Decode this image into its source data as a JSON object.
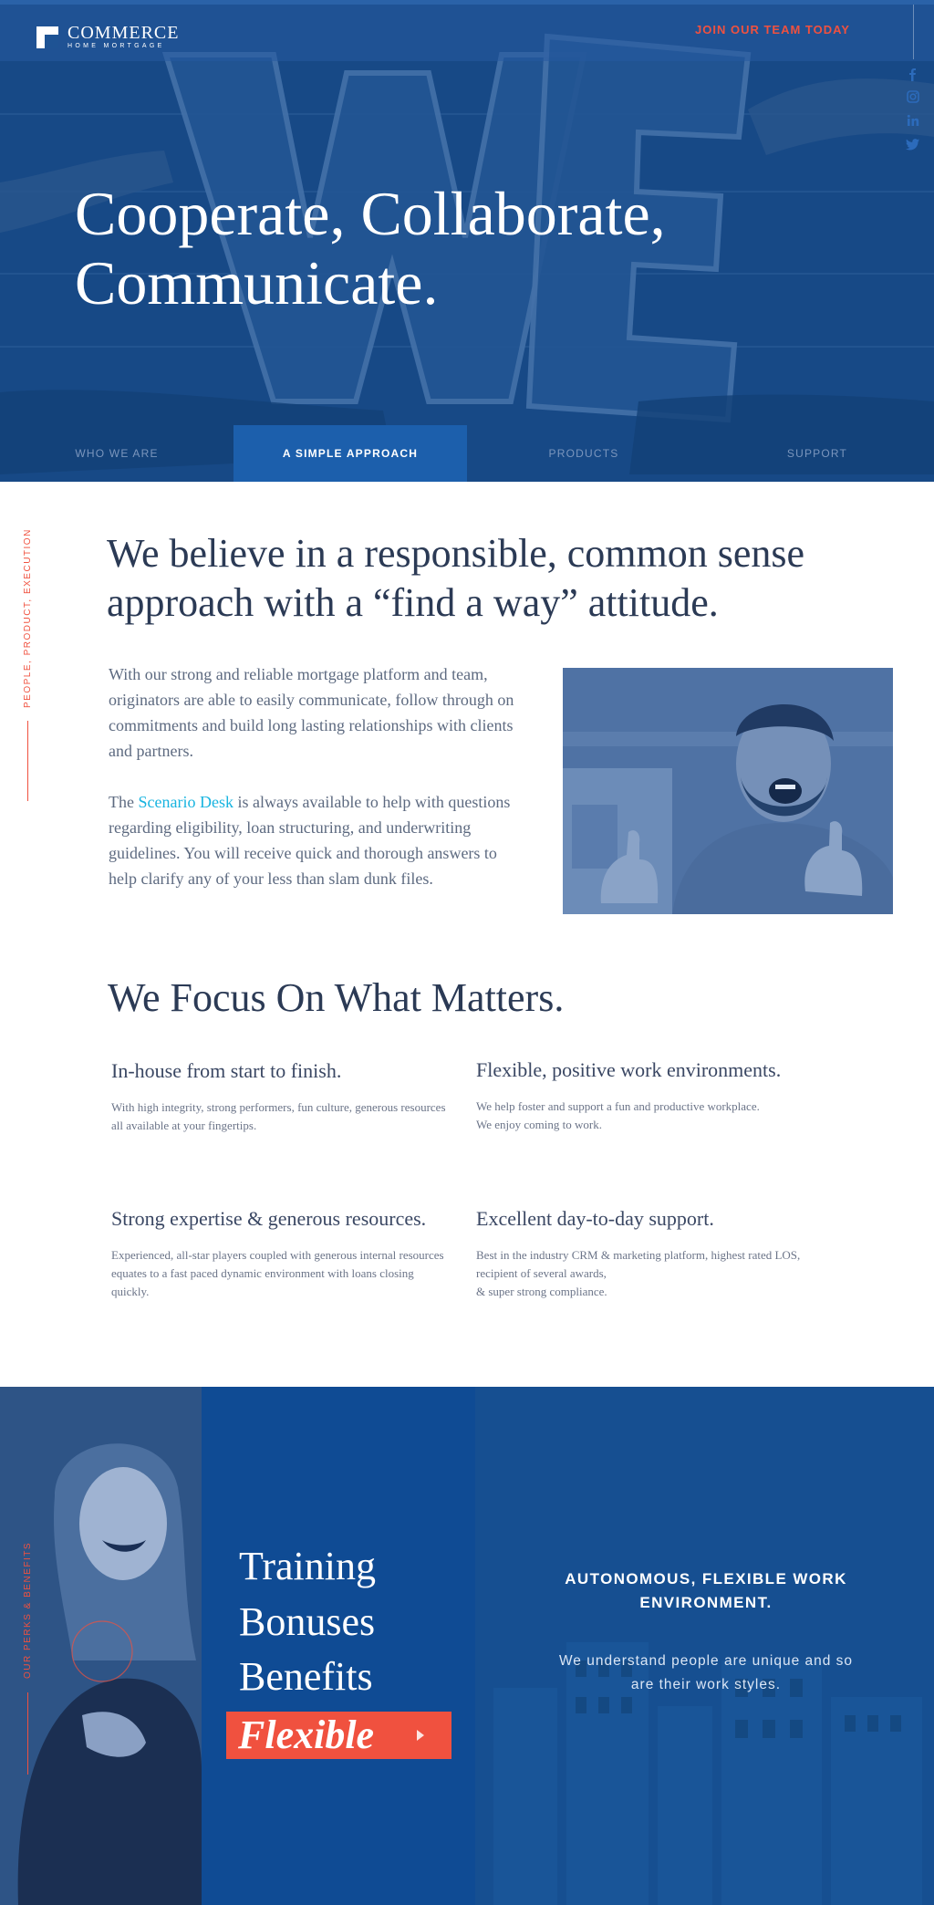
{
  "brand": {
    "name": "COMMERCE",
    "sub": "HOME MORTGAGE",
    "accent_color": "#f0513f",
    "primary_blue": "#134b8d",
    "link_color": "#18b4e0"
  },
  "header": {
    "join_label": "JOIN OUR TEAM TODAY",
    "social_icons": [
      "facebook-icon",
      "instagram-icon",
      "linkedin-icon",
      "twitter-icon"
    ]
  },
  "hero": {
    "title_line1": "Cooperate, Collaborate,",
    "title_line2": "Communicate.",
    "photo_text": "WE"
  },
  "nav": {
    "items": [
      {
        "label": "WHO WE ARE"
      },
      {
        "label": "A SIMPLE APPROACH"
      },
      {
        "label": "PRODUCTS"
      },
      {
        "label": "SUPPORT"
      }
    ],
    "active_index": 1
  },
  "intro": {
    "side_label": "PEOPLE, PRODUCT, EXECUTION",
    "title": "We believe in a responsible, common sense approach with a “find a way” attitude.",
    "paragraph1": "With our strong and reliable mortgage platform and team, originators are able to easily communicate, follow through on commitments and build long lasting relationships with clients and partners.",
    "paragraph2_before": "The ",
    "paragraph2_link": "Scenario Desk",
    "paragraph2_after": " is always available to help with questions regarding eligibility, loan structuring, and underwriting guidelines. You will receive quick and thorough answers to help clarify any of your less than slam dunk files."
  },
  "focus": {
    "title": "We Focus On What Matters.",
    "features": [
      {
        "title": "In-house from start to finish.",
        "text": "With high integrity, strong performers, fun culture, generous resources all available at your fingertips."
      },
      {
        "title": "Flexible, positive work environments.",
        "text": "We help foster and support a fun and productive workplace.\nWe enjoy coming to work."
      },
      {
        "title": "Strong expertise & generous resources.",
        "text": "Experienced, all-star players coupled with generous internal resources equates to a fast paced dynamic environment with loans closing quickly."
      },
      {
        "title": "Excellent day-to-day support.",
        "text": "Best in the industry CRM & marketing platform, highest rated LOS, recipient of several awards,\n& super strong compliance."
      }
    ]
  },
  "perks": {
    "side_label": "OUR PERKS & BENEFITS",
    "words": [
      "Training",
      "Bonuses",
      "Benefits"
    ],
    "button_label": "Flexible",
    "heading": "AUTONOMOUS, FLEXIBLE WORK ENVIRONMENT.",
    "text": "We understand people are unique and so are their work styles."
  }
}
